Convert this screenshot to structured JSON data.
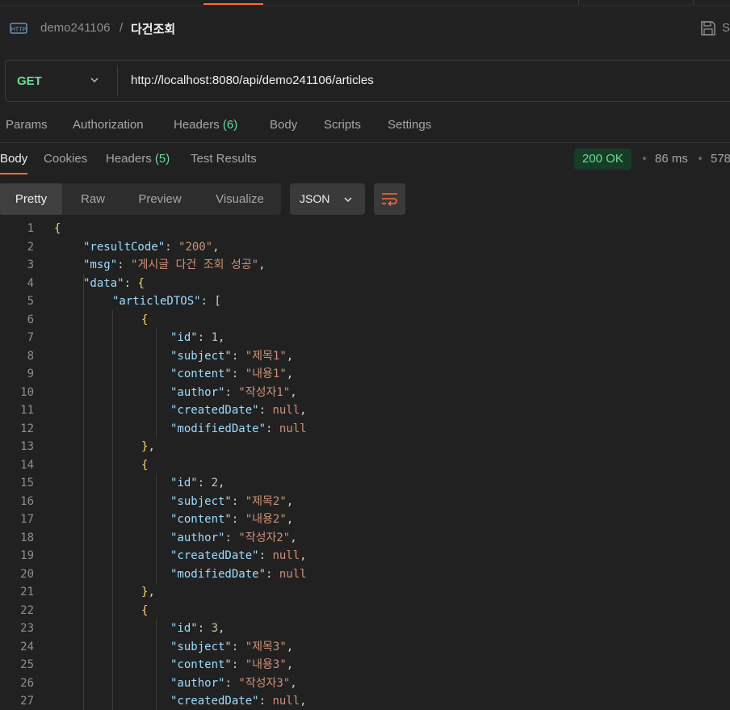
{
  "breadcrumb": {
    "collection": "demo241106",
    "separator": "/",
    "request": "다건조회"
  },
  "save_label": "S",
  "request": {
    "method": "GET",
    "url": "http://localhost:8080/api/demo241106/articles"
  },
  "request_tabs": [
    {
      "label": "Params"
    },
    {
      "label": "Authorization"
    },
    {
      "label": "Headers",
      "count": "(6)"
    },
    {
      "label": "Body"
    },
    {
      "label": "Scripts"
    },
    {
      "label": "Settings"
    }
  ],
  "response_tabs": [
    {
      "label": "Body"
    },
    {
      "label": "Cookies"
    },
    {
      "label": "Headers",
      "count": "(5)"
    },
    {
      "label": "Test Results"
    }
  ],
  "response_meta": {
    "status": "200 OK",
    "time": "86 ms",
    "size": "578"
  },
  "view_modes": [
    "Pretty",
    "Raw",
    "Preview",
    "Visualize"
  ],
  "active_view": "Pretty",
  "format": "JSON",
  "colors": {
    "accent": "#ff6c37",
    "status_green": "#6bdd9a",
    "json_key": "#9cdcfe",
    "json_string": "#ce9178",
    "json_number": "#b5cea8"
  },
  "code_lines": [
    {
      "n": "1",
      "indent": 0,
      "tokens": [
        [
          "br",
          "{"
        ]
      ]
    },
    {
      "n": "2",
      "indent": 1,
      "tokens": [
        [
          "k",
          "\"resultCode\""
        ],
        [
          "p",
          ": "
        ],
        [
          "s",
          "\"200\""
        ],
        [
          "p",
          ","
        ]
      ]
    },
    {
      "n": "3",
      "indent": 1,
      "tokens": [
        [
          "k",
          "\"msg\""
        ],
        [
          "p",
          ": "
        ],
        [
          "s",
          "\"게시글 다건 조회 성공\""
        ],
        [
          "p",
          ","
        ]
      ]
    },
    {
      "n": "4",
      "indent": 1,
      "tokens": [
        [
          "k",
          "\"data\""
        ],
        [
          "p",
          ": "
        ],
        [
          "br",
          "{"
        ]
      ]
    },
    {
      "n": "5",
      "indent": 2,
      "tokens": [
        [
          "k",
          "\"articleDTOS\""
        ],
        [
          "p",
          ": ["
        ]
      ]
    },
    {
      "n": "6",
      "indent": 3,
      "tokens": [
        [
          "br",
          "{"
        ]
      ]
    },
    {
      "n": "7",
      "indent": 4,
      "tokens": [
        [
          "k",
          "\"id\""
        ],
        [
          "p",
          ": "
        ],
        [
          "n",
          "1"
        ],
        [
          "p",
          ","
        ]
      ]
    },
    {
      "n": "8",
      "indent": 4,
      "tokens": [
        [
          "k",
          "\"subject\""
        ],
        [
          "p",
          ": "
        ],
        [
          "s",
          "\"제목1\""
        ],
        [
          "p",
          ","
        ]
      ]
    },
    {
      "n": "9",
      "indent": 4,
      "tokens": [
        [
          "k",
          "\"content\""
        ],
        [
          "p",
          ": "
        ],
        [
          "s",
          "\"내용1\""
        ],
        [
          "p",
          ","
        ]
      ]
    },
    {
      "n": "10",
      "indent": 4,
      "tokens": [
        [
          "k",
          "\"author\""
        ],
        [
          "p",
          ": "
        ],
        [
          "s",
          "\"작성자1\""
        ],
        [
          "p",
          ","
        ]
      ]
    },
    {
      "n": "11",
      "indent": 4,
      "tokens": [
        [
          "k",
          "\"createdDate\""
        ],
        [
          "p",
          ": "
        ],
        [
          "kw",
          "null"
        ],
        [
          "p",
          ","
        ]
      ]
    },
    {
      "n": "12",
      "indent": 4,
      "tokens": [
        [
          "k",
          "\"modifiedDate\""
        ],
        [
          "p",
          ": "
        ],
        [
          "kw",
          "null"
        ]
      ]
    },
    {
      "n": "13",
      "indent": 3,
      "tokens": [
        [
          "br",
          "}"
        ],
        [
          "p",
          ","
        ]
      ]
    },
    {
      "n": "14",
      "indent": 3,
      "tokens": [
        [
          "br",
          "{"
        ]
      ]
    },
    {
      "n": "15",
      "indent": 4,
      "tokens": [
        [
          "k",
          "\"id\""
        ],
        [
          "p",
          ": "
        ],
        [
          "n",
          "2"
        ],
        [
          "p",
          ","
        ]
      ]
    },
    {
      "n": "16",
      "indent": 4,
      "tokens": [
        [
          "k",
          "\"subject\""
        ],
        [
          "p",
          ": "
        ],
        [
          "s",
          "\"제목2\""
        ],
        [
          "p",
          ","
        ]
      ]
    },
    {
      "n": "17",
      "indent": 4,
      "tokens": [
        [
          "k",
          "\"content\""
        ],
        [
          "p",
          ": "
        ],
        [
          "s",
          "\"내용2\""
        ],
        [
          "p",
          ","
        ]
      ]
    },
    {
      "n": "18",
      "indent": 4,
      "tokens": [
        [
          "k",
          "\"author\""
        ],
        [
          "p",
          ": "
        ],
        [
          "s",
          "\"작성자2\""
        ],
        [
          "p",
          ","
        ]
      ]
    },
    {
      "n": "19",
      "indent": 4,
      "tokens": [
        [
          "k",
          "\"createdDate\""
        ],
        [
          "p",
          ": "
        ],
        [
          "kw",
          "null"
        ],
        [
          "p",
          ","
        ]
      ]
    },
    {
      "n": "20",
      "indent": 4,
      "tokens": [
        [
          "k",
          "\"modifiedDate\""
        ],
        [
          "p",
          ": "
        ],
        [
          "kw",
          "null"
        ]
      ]
    },
    {
      "n": "21",
      "indent": 3,
      "tokens": [
        [
          "br",
          "}"
        ],
        [
          "p",
          ","
        ]
      ]
    },
    {
      "n": "22",
      "indent": 3,
      "tokens": [
        [
          "br",
          "{"
        ]
      ]
    },
    {
      "n": "23",
      "indent": 4,
      "tokens": [
        [
          "k",
          "\"id\""
        ],
        [
          "p",
          ": "
        ],
        [
          "n",
          "3"
        ],
        [
          "p",
          ","
        ]
      ]
    },
    {
      "n": "24",
      "indent": 4,
      "tokens": [
        [
          "k",
          "\"subject\""
        ],
        [
          "p",
          ": "
        ],
        [
          "s",
          "\"제목3\""
        ],
        [
          "p",
          ","
        ]
      ]
    },
    {
      "n": "25",
      "indent": 4,
      "tokens": [
        [
          "k",
          "\"content\""
        ],
        [
          "p",
          ": "
        ],
        [
          "s",
          "\"내용3\""
        ],
        [
          "p",
          ","
        ]
      ]
    },
    {
      "n": "26",
      "indent": 4,
      "tokens": [
        [
          "k",
          "\"author\""
        ],
        [
          "p",
          ": "
        ],
        [
          "s",
          "\"작성자3\""
        ],
        [
          "p",
          ","
        ]
      ]
    },
    {
      "n": "27",
      "indent": 4,
      "tokens": [
        [
          "k",
          "\"createdDate\""
        ],
        [
          "p",
          ": "
        ],
        [
          "kw",
          "null"
        ],
        [
          "p",
          ","
        ]
      ]
    }
  ]
}
